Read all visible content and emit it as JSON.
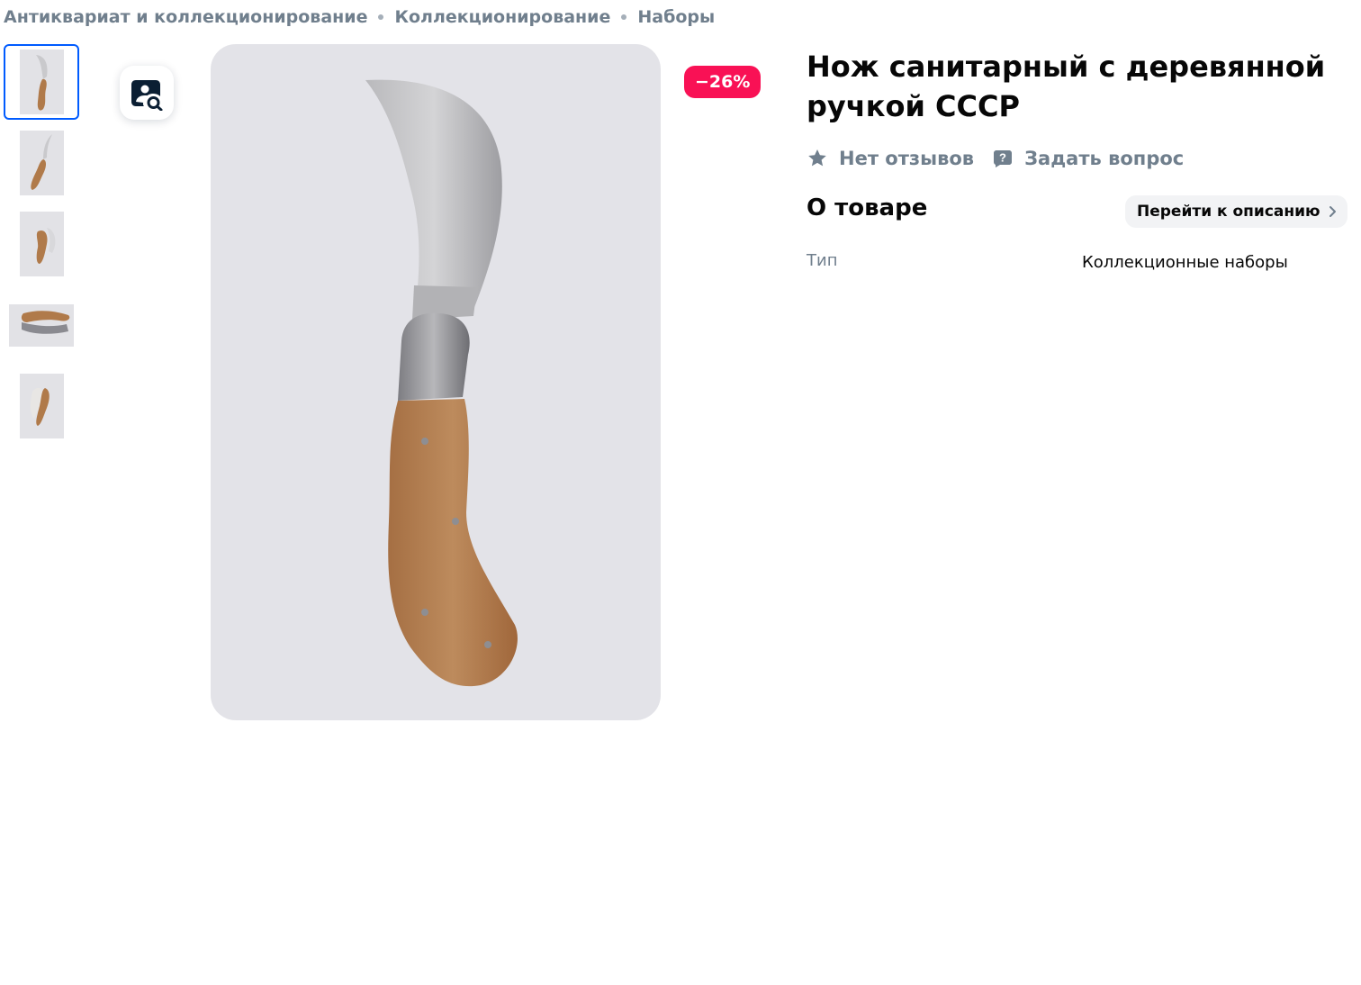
{
  "breadcrumb": {
    "items": [
      "Антиквариат и коллекционирование",
      "Коллекционирование",
      "Наборы"
    ]
  },
  "gallery": {
    "thumbnails": 5,
    "active_index": 0
  },
  "product": {
    "discount": "−26%",
    "title": "Нож санитарный с деревянной ручкой СССР",
    "reviews": "Нет отзывов",
    "ask_question": "Задать вопрос"
  },
  "about": {
    "title": "О товаре",
    "goto_description": "Перейти к описанию",
    "properties": [
      {
        "label": "Тип",
        "value": "Коллекционные наборы"
      }
    ]
  },
  "colors": {
    "accent": "#005bff",
    "discount_bg": "#f91155",
    "muted_text": "#707f8d",
    "photo_bg": "#e3e3e8"
  },
  "icons": {
    "zoom": "magnify-image-icon",
    "star": "star-icon",
    "question": "question-bubble-icon",
    "chevron": "chevron-right-icon"
  }
}
